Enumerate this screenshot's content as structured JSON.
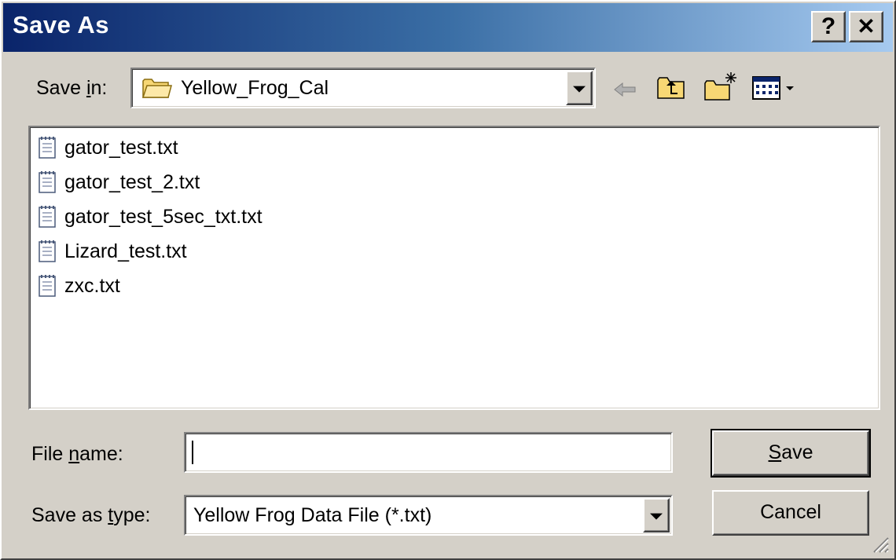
{
  "window": {
    "title": "Save As"
  },
  "titlebar_buttons": {
    "help": "?",
    "close": "✕"
  },
  "save_in": {
    "label_prefix": "Save ",
    "label_mnemonic": "i",
    "label_suffix": "n:",
    "current_folder": "Yellow_Frog_Cal"
  },
  "toolbar": {
    "back_icon": "back-arrow-icon",
    "up_icon": "up-one-level-icon",
    "new_folder_icon": "new-folder-icon",
    "views_icon": "views-menu-icon"
  },
  "files": [
    {
      "name": "gator_test.txt"
    },
    {
      "name": "gator_test_2.txt"
    },
    {
      "name": "gator_test_5sec_txt.txt"
    },
    {
      "name": "Lizard_test.txt"
    },
    {
      "name": "zxc.txt"
    }
  ],
  "file_name": {
    "label_prefix": "File ",
    "label_mnemonic": "n",
    "label_suffix": "ame:",
    "value": ""
  },
  "save_as_type": {
    "label_prefix": "Save as ",
    "label_mnemonic": "t",
    "label_suffix": "ype:",
    "selected": "Yellow Frog Data File (*.txt)"
  },
  "buttons": {
    "save_mnemonic": "S",
    "save_rest": "ave",
    "cancel": "Cancel"
  },
  "colors": {
    "title_gradient_start": "#0a246a",
    "title_gradient_end": "#a6caf0",
    "dialog_face": "#d4d0c8",
    "folder_yellow": "#f7d774"
  }
}
